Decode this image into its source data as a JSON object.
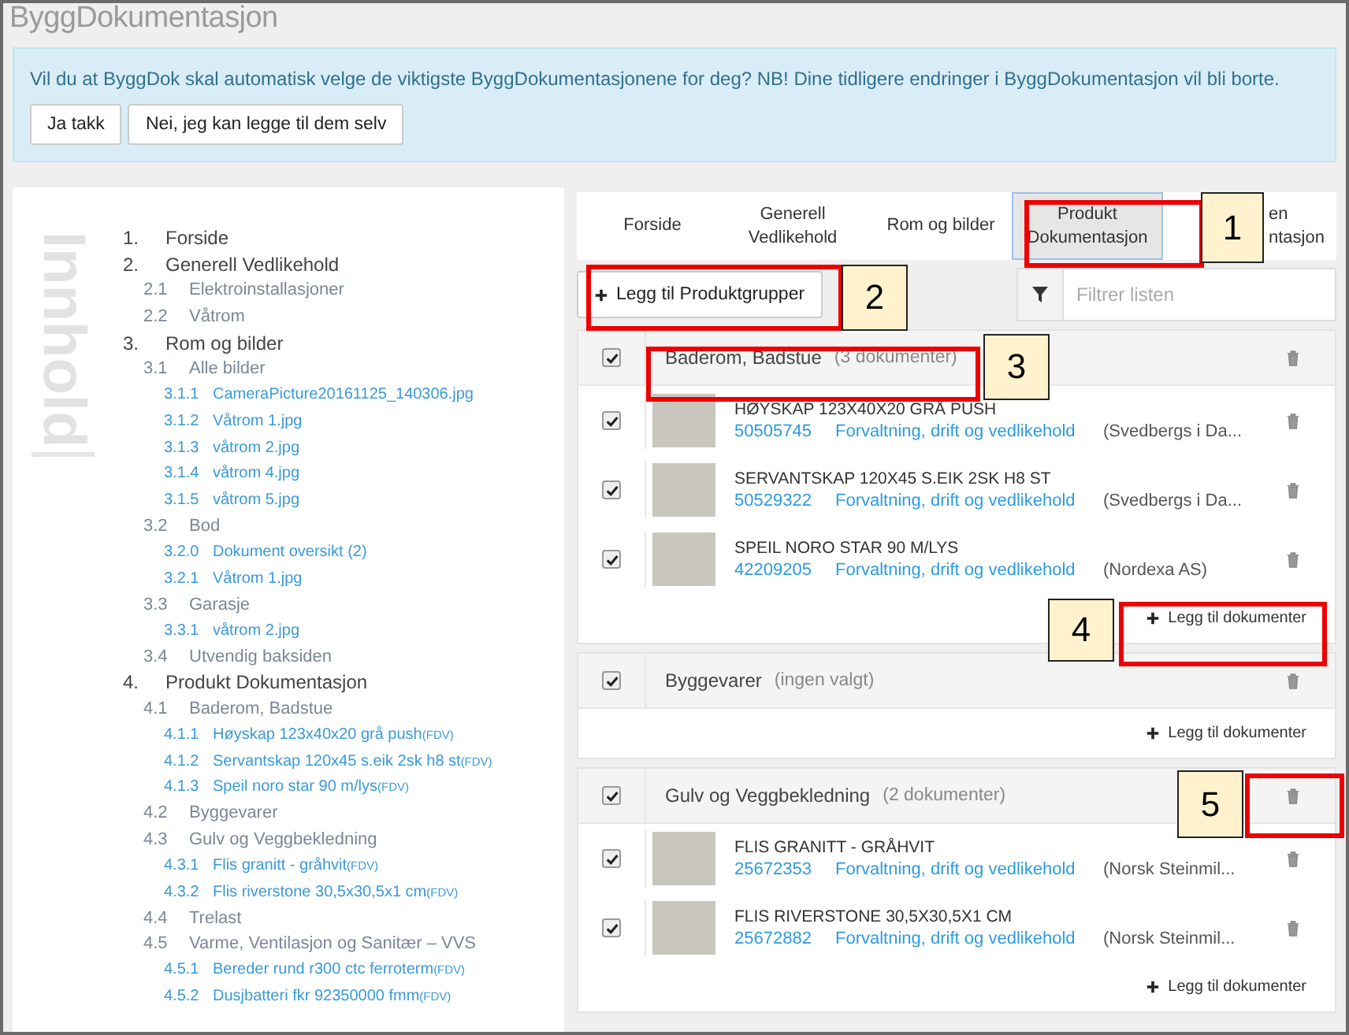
{
  "app_title": "ByggDokumentasjon",
  "notice": {
    "message": "Vil du at ByggDok skal automatisk velge de viktigste ByggDokumentasjonene for deg? NB! Dine tidligere endringer i ByggDokumentasjon vil bli borte.",
    "buttons": [
      "Ja takk",
      "Nei, jeg kan legge til dem selv"
    ]
  },
  "sidebar": {
    "heading": "Innhold",
    "outline": [
      {
        "num": "1.",
        "label": "Forside"
      },
      {
        "num": "2.",
        "label": "Generell Vedlikehold",
        "children": [
          {
            "num": "2.1",
            "label": "Elektroinstallasjoner"
          },
          {
            "num": "2.2",
            "label": "Våtrom"
          }
        ]
      },
      {
        "num": "3.",
        "label": "Rom og bilder",
        "children": [
          {
            "num": "3.1",
            "label": "Alle bilder",
            "children": [
              {
                "num": "3.1.1",
                "label": "CameraPicture20161125_140306.jpg"
              },
              {
                "num": "3.1.2",
                "label": "Våtrom 1.jpg"
              },
              {
                "num": "3.1.3",
                "label": "våtrom 2.jpg"
              },
              {
                "num": "3.1.4",
                "label": "våtrom 4.jpg"
              },
              {
                "num": "3.1.5",
                "label": "våtrom 5.jpg"
              }
            ]
          },
          {
            "num": "3.2",
            "label": "Bod",
            "children": [
              {
                "num": "3.2.0",
                "label": "Dokument oversikt (2)"
              },
              {
                "num": "3.2.1",
                "label": "Våtrom 1.jpg"
              }
            ]
          },
          {
            "num": "3.3",
            "label": "Garasje",
            "children": [
              {
                "num": "3.3.1",
                "label": "våtrom 2.jpg"
              }
            ]
          },
          {
            "num": "3.4",
            "label": "Utvendig baksiden"
          }
        ]
      },
      {
        "num": "4.",
        "label": "Produkt Dokumentasjon",
        "children": [
          {
            "num": "4.1",
            "label": "Baderom, Badstue",
            "children": [
              {
                "num": "4.1.1",
                "label": "Høyskap 123x40x20 grå push",
                "tag": "(FDV)"
              },
              {
                "num": "4.1.2",
                "label": "Servantskap 120x45 s.eik 2sk h8 st",
                "tag": "(FDV)"
              },
              {
                "num": "4.1.3",
                "label": "Speil noro star 90 m/lys",
                "tag": "(FDV)"
              }
            ]
          },
          {
            "num": "4.2",
            "label": "Byggevarer"
          },
          {
            "num": "4.3",
            "label": "Gulv og Veggbekledning",
            "children": [
              {
                "num": "4.3.1",
                "label": "Flis granitt - gråhvit",
                "tag": "(FDV)"
              },
              {
                "num": "4.3.2",
                "label": "Flis riverstone 30,5x30,5x1 cm",
                "tag": "(FDV)"
              }
            ]
          },
          {
            "num": "4.4",
            "label": "Trelast"
          },
          {
            "num": "4.5",
            "label": "Varme, Ventilasjon og Sanitær – VVS",
            "children": [
              {
                "num": "4.5.1",
                "label": "Bereder rund r300 ctc ferroterm",
                "tag": "(FDV)"
              },
              {
                "num": "4.5.2",
                "label": "Dusjbatteri fkr 92350000 fmm",
                "tag": "(FDV)"
              }
            ]
          }
        ]
      }
    ]
  },
  "tabs": [
    {
      "label": "Forside",
      "selected": false
    },
    {
      "label": "Generell\nVedlikehold",
      "selected": false
    },
    {
      "label": "Rom og bilder",
      "selected": false
    },
    {
      "label": "Produkt\nDokumentasjon",
      "selected": true
    },
    {
      "label": "en\nntasjon",
      "selected": false
    }
  ],
  "add_groups_button": "Legg til Produktgrupper",
  "filter": {
    "placeholder": "Filtrer listen"
  },
  "groups": [
    {
      "name": "Baderom, Badstue",
      "count": "(3 dokumenter)",
      "checked": true,
      "add_button": "Legg til dokumenter",
      "items": [
        {
          "title": "HØYSKAP 123X40X20 GRÅ PUSH",
          "number": "50505745",
          "category": "Forvaltning, drift og vedlikehold",
          "supplier": "(Svedbergs i Da...",
          "checked": true
        },
        {
          "title": "SERVANTSKAP 120X45 S.EIK 2SK H8 ST",
          "number": "50529322",
          "category": "Forvaltning, drift og vedlikehold",
          "supplier": "(Svedbergs i Da...",
          "checked": true
        },
        {
          "title": "SPEIL NORO STAR 90 M/LYS",
          "number": "42209205",
          "category": "Forvaltning, drift og vedlikehold",
          "supplier": "(Nordexa AS)",
          "checked": true
        }
      ]
    },
    {
      "name": "Byggevarer",
      "count": "(ingen valgt)",
      "checked": true,
      "add_button": "Legg til dokumenter"
    },
    {
      "name": "Gulv og Veggbekledning",
      "count": "(2 dokumenter)",
      "checked": true,
      "add_button": "Legg til dokumenter",
      "items": [
        {
          "title": "FLIS GRANITT - GRÅHVIT",
          "number": "25672353",
          "category": "Forvaltning, drift og vedlikehold",
          "supplier": "(Norsk Steinmil...",
          "checked": true
        },
        {
          "title": "FLIS RIVERSTONE 30,5X30,5X1 CM",
          "number": "25672882",
          "category": "Forvaltning, drift og vedlikehold",
          "supplier": "(Norsk Steinmil...",
          "checked": true
        }
      ]
    }
  ],
  "annotations": [
    {
      "label": "1"
    },
    {
      "label": "2"
    },
    {
      "label": "3"
    },
    {
      "label": "4"
    },
    {
      "label": "5"
    }
  ]
}
